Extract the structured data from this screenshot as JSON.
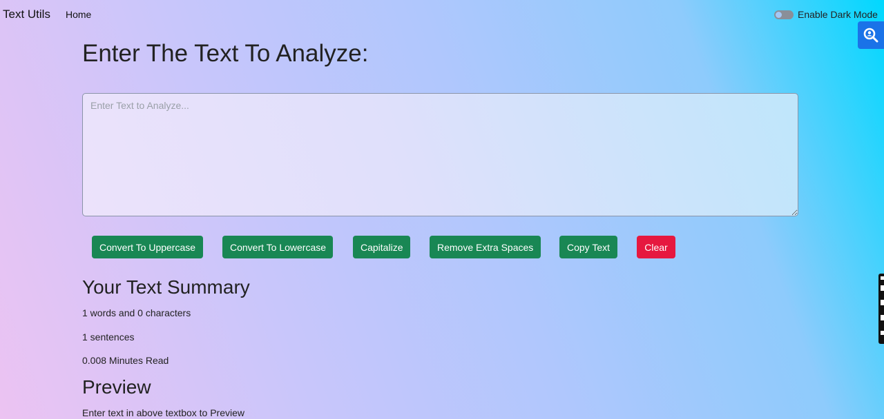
{
  "navbar": {
    "brand": "Text Utils",
    "home": "Home",
    "dark_mode_label": "Enable Dark Mode"
  },
  "main": {
    "heading": "Enter The Text To Analyze:",
    "textarea_placeholder": "Enter Text to Analyze...",
    "textarea_value": ""
  },
  "buttons": {
    "uppercase": "Convert To Uppercase",
    "lowercase": "Convert To Lowercase",
    "capitalize": "Capitalize",
    "remove_spaces": "Remove Extra Spaces",
    "copy": "Copy Text",
    "clear": "Clear"
  },
  "summary": {
    "title": "Your Text Summary",
    "counts": "1 words and 0 characters",
    "sentences": "1 sentences",
    "read_time": "0.008 Minutes Read"
  },
  "preview": {
    "title": "Preview",
    "text": "Enter text in above textbox to Preview"
  },
  "icons": {
    "side_widget": "magnifier-search-icon"
  },
  "colors": {
    "primary_button": "#198754",
    "danger_button": "#e6183f",
    "side_widget": "#1a73e8"
  }
}
